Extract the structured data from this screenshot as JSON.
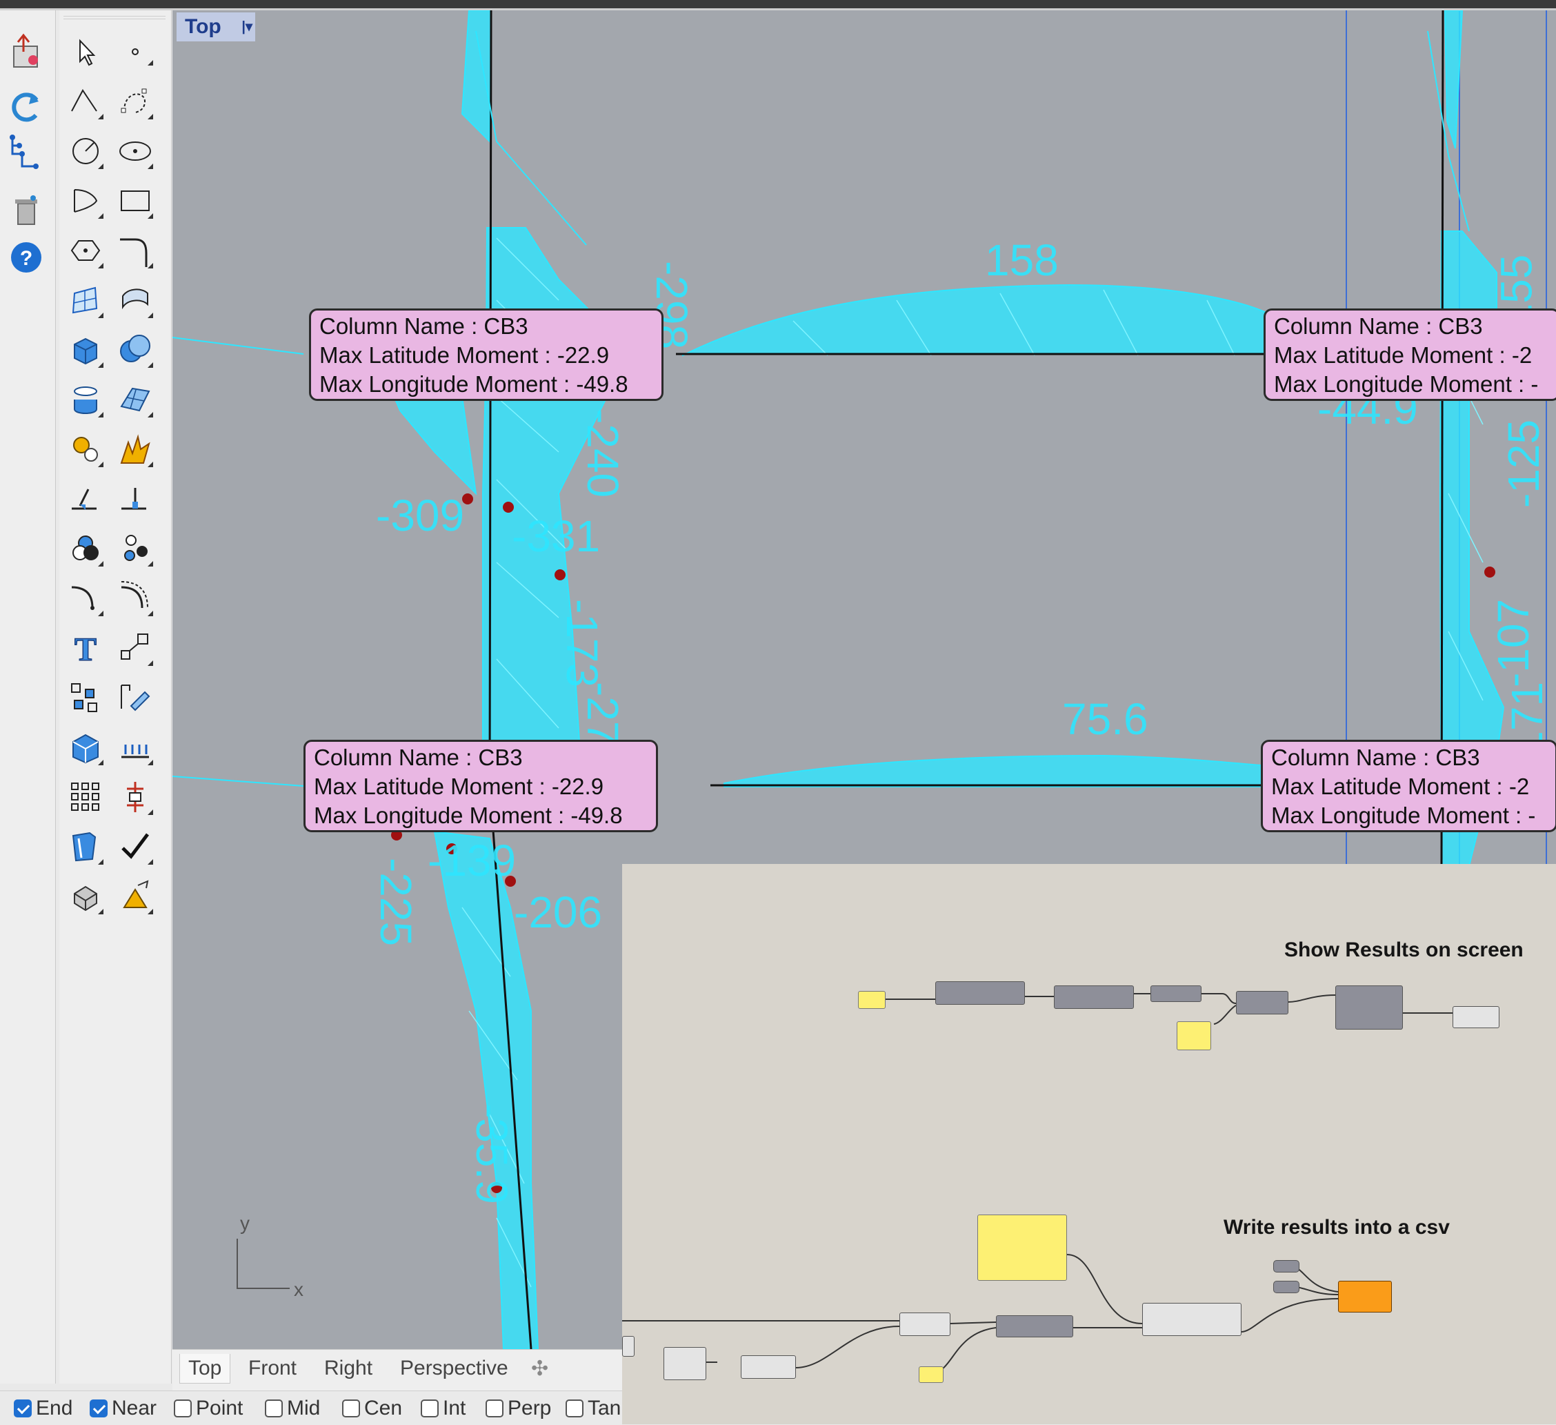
{
  "viewport": {
    "label": "Top",
    "callouts": [
      {
        "line1": "Column Name : CB3",
        "line2": "Max Latitude Moment  : -22.9",
        "line3": "Max Longitude Moment : -49.8"
      },
      {
        "line1": "Column Name : CB3",
        "line2": "Max Latitude Moment  : -2",
        "line3": "Max Longitude Moment : -"
      },
      {
        "line1": "Column Name : CB3",
        "line2": "Max Latitude Moment  : -22.9",
        "line3": "Max Longitude Moment : -49.8"
      },
      {
        "line1": "Column Name : CB3",
        "line2": "Max Latitude Moment  : -2",
        "line3": "Max Longitude Moment : -"
      }
    ],
    "values": [
      "158",
      "75.6",
      "-309",
      "-331",
      "-298",
      "-240",
      "-173",
      "-270",
      "-225",
      "-139",
      "-206",
      "-35.9",
      "155",
      "-125",
      "-107",
      "-171",
      "-44.9"
    ],
    "axes": {
      "x": "x",
      "y": "y"
    }
  },
  "view_tabs": {
    "tabs": [
      "Top",
      "Front",
      "Right",
      "Perspective"
    ],
    "add_icon": "plus-icon"
  },
  "osnap": [
    {
      "label": "End",
      "checked": true
    },
    {
      "label": "Near",
      "checked": true
    },
    {
      "label": "Point",
      "checked": false
    },
    {
      "label": "Mid",
      "checked": false
    },
    {
      "label": "Cen",
      "checked": false
    },
    {
      "label": "Int",
      "checked": false
    },
    {
      "label": "Perp",
      "checked": false
    },
    {
      "label": "Tan",
      "checked": false
    }
  ],
  "grasshopper": {
    "group1_title": "Show Results on screen",
    "group2_title": "Write results into a csv"
  },
  "colors": {
    "analysis": "#2ee6ff",
    "callout": "#e9b7e3",
    "viewport_bg": "#a3a7ad",
    "canvas_bg": "#d8d4cc",
    "panel": "#fdf073",
    "output": "#fa9c19"
  }
}
